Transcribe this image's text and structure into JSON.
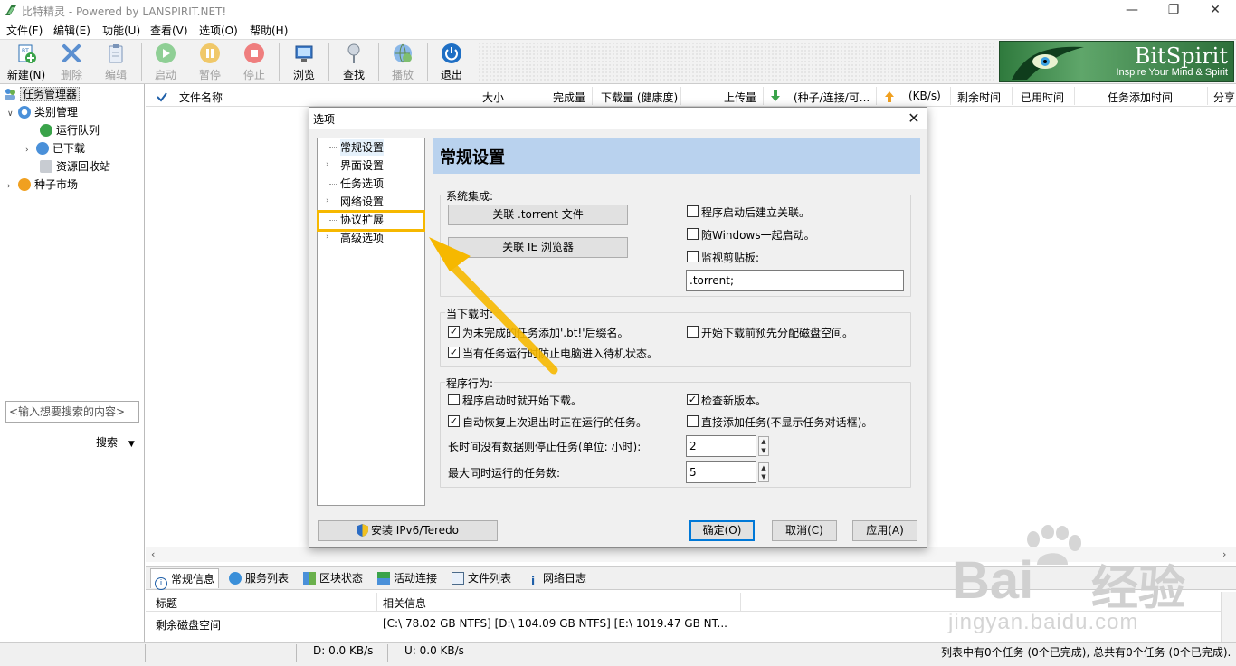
{
  "window": {
    "title": "比特精灵 - Powered by LANSPIRIT.NET!",
    "minimize_glyph": "—",
    "restore_glyph": "❐",
    "close_glyph": "✕"
  },
  "menu": [
    "文件(F)",
    "编辑(E)",
    "功能(U)",
    "查看(V)",
    "选项(O)",
    "帮助(H)"
  ],
  "toolbar": {
    "buttons": [
      {
        "label": "新建(N)",
        "icon": "new-torrent-icon",
        "enabled": true
      },
      {
        "label": "删除",
        "icon": "delete-x-icon",
        "enabled": false
      },
      {
        "label": "编辑",
        "icon": "edit-clipboard-icon",
        "enabled": false
      },
      {
        "label": "启动",
        "icon": "play-icon",
        "enabled": false
      },
      {
        "label": "暂停",
        "icon": "pause-icon",
        "enabled": false
      },
      {
        "label": "停止",
        "icon": "stop-icon",
        "enabled": false
      },
      {
        "label": "浏览",
        "icon": "browse-monitor-icon",
        "enabled": true
      },
      {
        "label": "查找",
        "icon": "find-pin-icon",
        "enabled": true
      },
      {
        "label": "播放",
        "icon": "play-globe-icon",
        "enabled": false
      },
      {
        "label": "退出",
        "icon": "power-icon",
        "enabled": true
      }
    ],
    "brand_name": "BitSpirit",
    "brand_tagline": "Inspire Your Mind & Spirit"
  },
  "left_tree": {
    "root": "任务管理器",
    "category": "类别管理",
    "items": [
      "运行队列",
      "已下载",
      "资源回收站"
    ],
    "market": "种子市场",
    "search_placeholder": "<输入想要搜索的内容>",
    "search_label": "搜索"
  },
  "columns": [
    "文件名称",
    "大小",
    "完成量",
    "下载量 (健康度)",
    "上传量",
    "(种子/连接/可...",
    "(KB/s)",
    "剩余时间",
    "已用时间",
    "任务添加时间",
    "分享"
  ],
  "bottom_tabs": [
    "常规信息",
    "服务列表",
    "区块状态",
    "活动连接",
    "文件列表",
    "网络日志"
  ],
  "info": {
    "header_title": "标题",
    "header_info": "相关信息",
    "row_label": "剩余磁盘空间",
    "row_value": "[C:\\ 78.02 GB  NTFS]  [D:\\ 104.09 GB  NTFS]  [E:\\ 1019.47 GB  NT..."
  },
  "status": {
    "down": "D: 0.0 KB/s",
    "up": "U: 0.0 KB/s",
    "summary": "列表中有0个任务 (0个已完成), 总共有0个任务 (0个已完成)."
  },
  "dialog": {
    "title": "选项",
    "nav": [
      "常规设置",
      "界面设置",
      "任务选项",
      "网络设置",
      "协议扩展",
      "高级选项"
    ],
    "panel_title": "常规设置",
    "system_group": "系统集成:",
    "assoc_torrent_button": "关联 .torrent 文件",
    "assoc_ie_button": "关联 IE 浏览器",
    "chk_startup_assoc": "程序启动后建立关联。",
    "chk_with_windows": "随Windows一起启动。",
    "chk_clipboard": "监视剪贴板:",
    "clipboard_value": ".torrent;",
    "download_group": "当下载时:",
    "chk_add_bt_suffix": "为未完成的任务添加'.bt!'后缀名。",
    "chk_prealloc": "开始下载前预先分配磁盘空间。",
    "chk_prevent_standby": "当有任务运行时防止电脑进入待机状态。",
    "behavior_group": "程序行为:",
    "chk_start_on_launch": "程序启动时就开始下载。",
    "chk_check_update": "检查新版本。",
    "chk_auto_resume": "自动恢复上次退出时正在运行的任务。",
    "chk_direct_add": "直接添加任务(不显示任务对话框)。",
    "idle_stop_label": "长时间没有数据则停止任务(单位: 小时):",
    "idle_stop_value": "2",
    "max_tasks_label": "最大同时运行的任务数:",
    "max_tasks_value": "5",
    "ipv6_button": "安装 IPv6/Teredo",
    "ok_button": "确定(O)",
    "cancel_button": "取消(C)",
    "apply_button": "应用(A)",
    "checks": {
      "startup_assoc": false,
      "with_windows": false,
      "clipboard": false,
      "add_bt_suffix": true,
      "prealloc": false,
      "prevent_standby": true,
      "start_on_launch": false,
      "check_update": true,
      "auto_resume": true,
      "direct_add": false
    }
  },
  "watermark": {
    "brand": "Bai",
    "brand_cn": "经验",
    "url": "jingyan.baidu.com"
  },
  "colors": {
    "highlight_box": "#f6b800",
    "panel_header": "#b9d2ee",
    "brand_green": "#2f7a3d",
    "arrow": "#f6b800"
  }
}
